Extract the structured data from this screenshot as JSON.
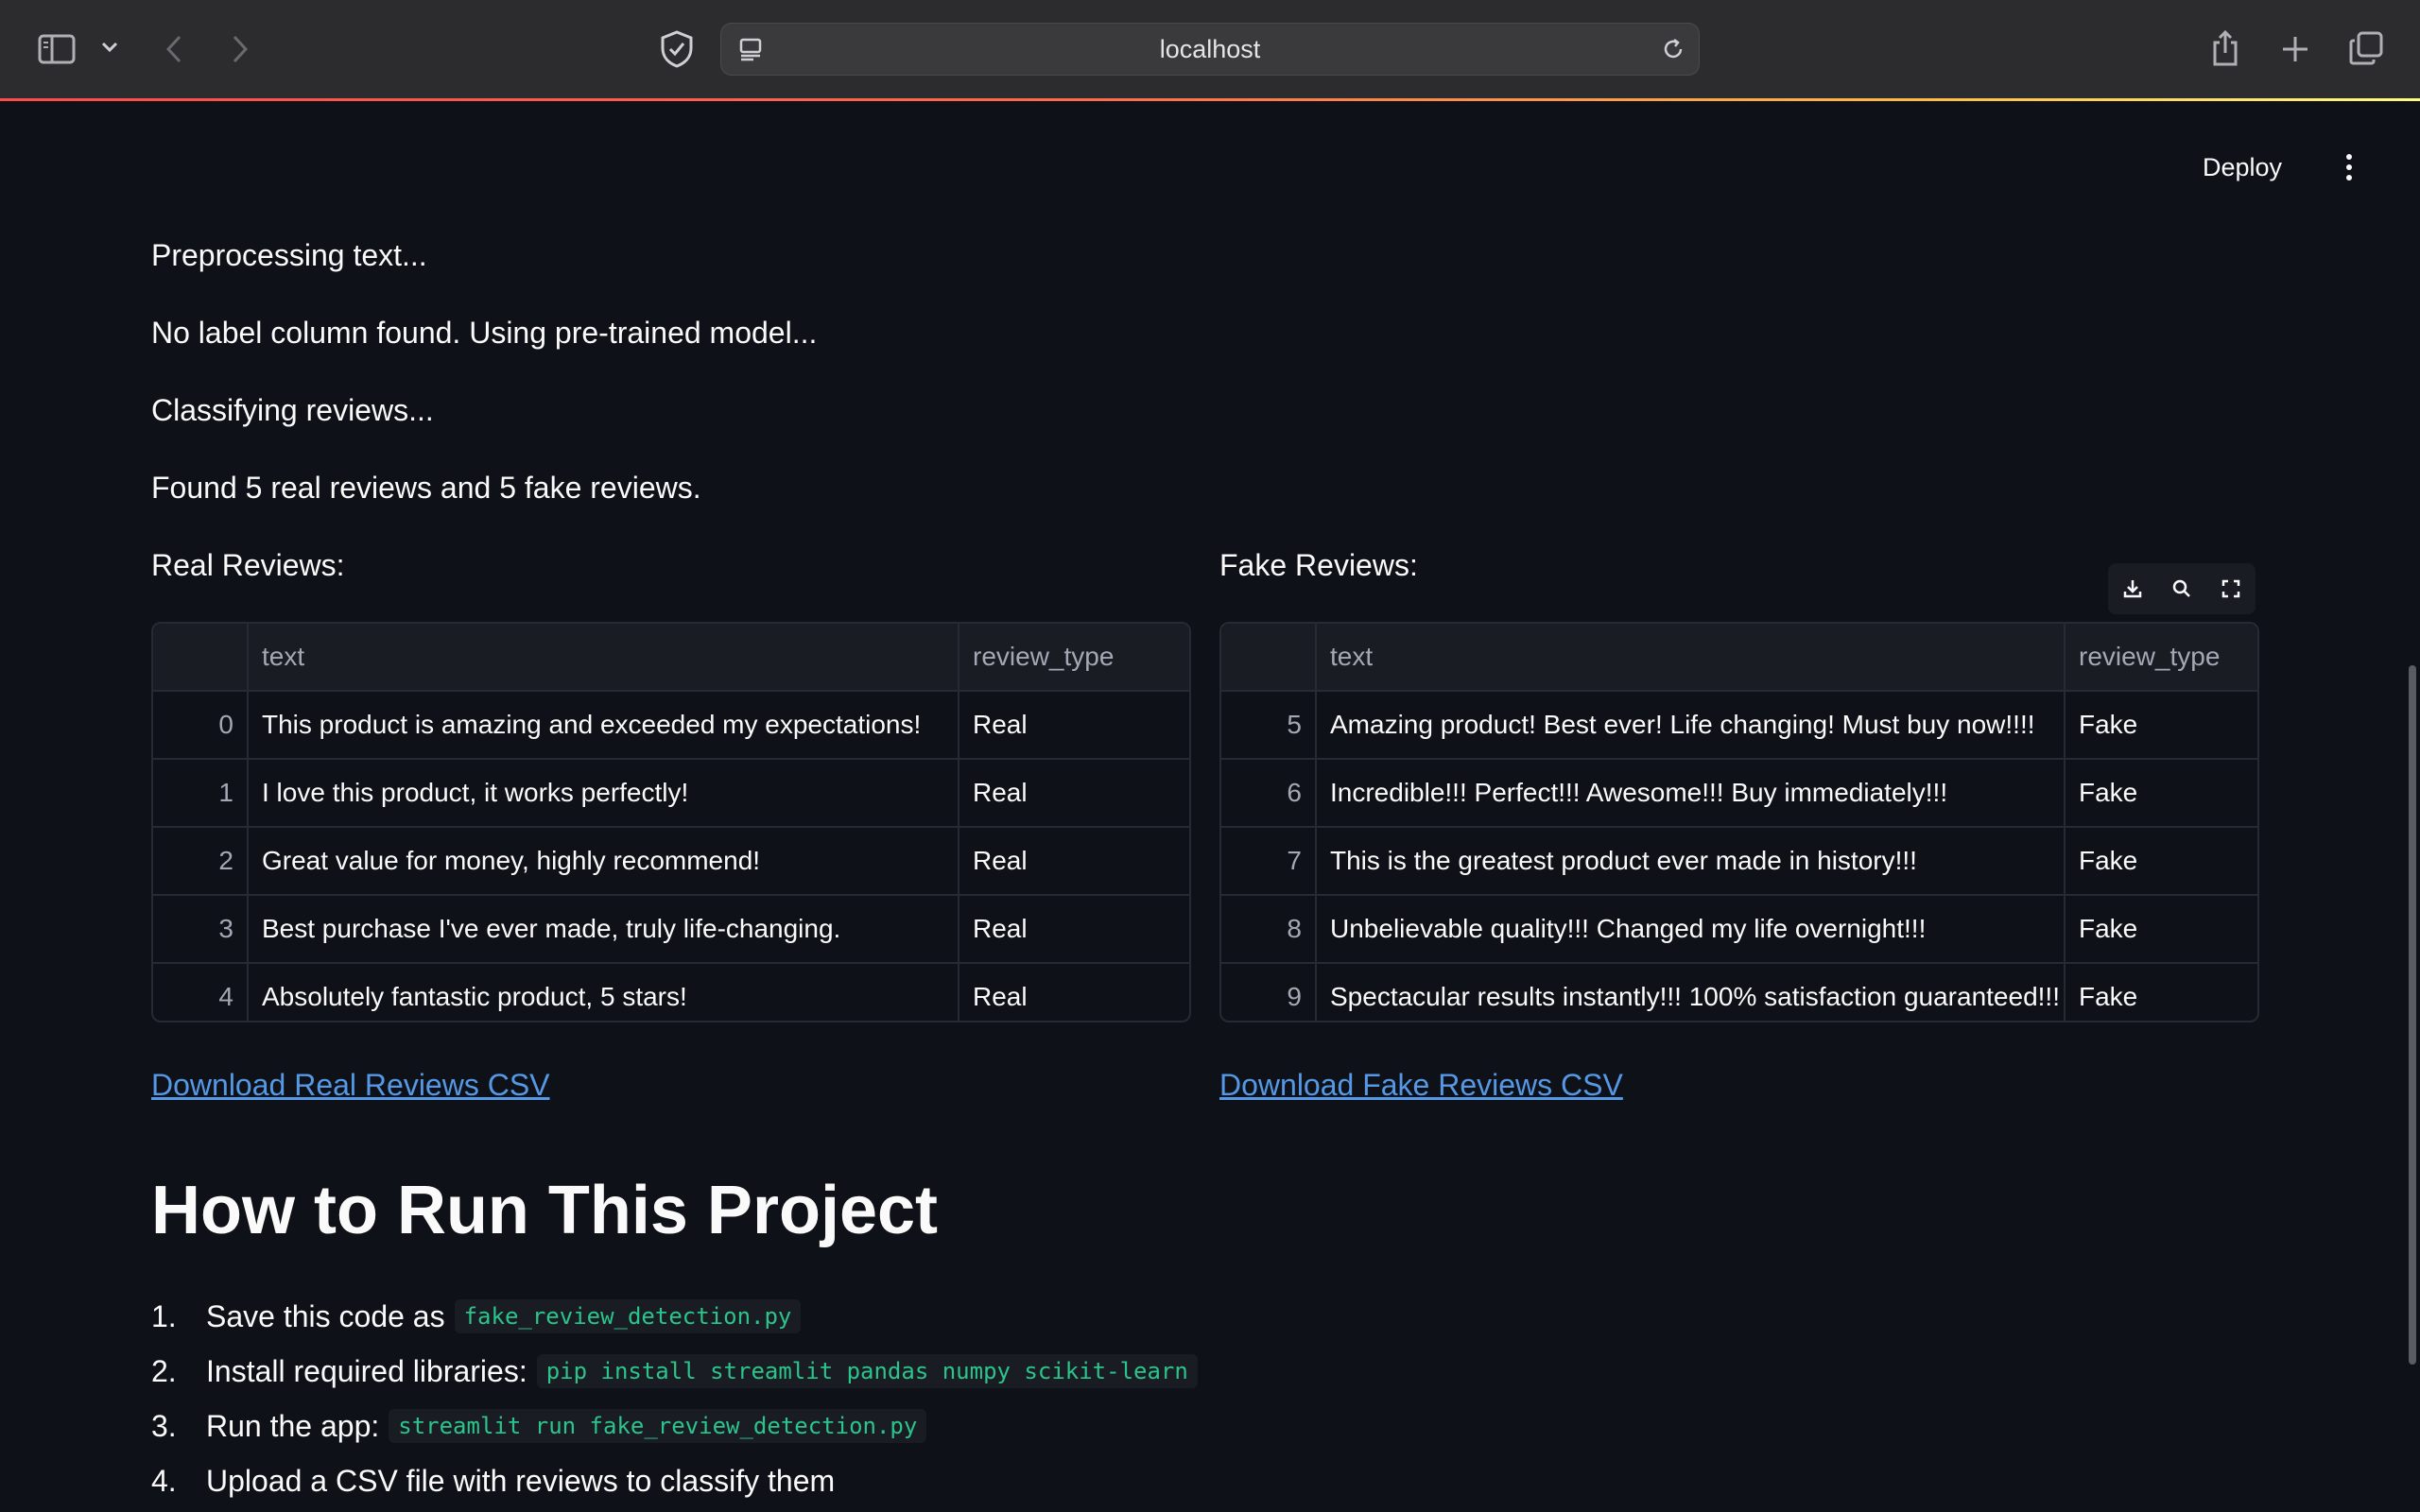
{
  "browser": {
    "url": "localhost"
  },
  "app_header": {
    "deploy_label": "Deploy"
  },
  "status": {
    "preprocessing": "Preprocessing text...",
    "no_label": "No label column found. Using pre-trained model...",
    "classifying": "Classifying reviews...",
    "found": "Found 5 real reviews and 5 fake reviews."
  },
  "real": {
    "title": "Real Reviews:",
    "columns": [
      "",
      "text",
      "review_type"
    ],
    "rows": [
      {
        "index": "0",
        "text": "This product is amazing and exceeded my expectations!",
        "type": "Real"
      },
      {
        "index": "1",
        "text": "I love this product, it works perfectly!",
        "type": "Real"
      },
      {
        "index": "2",
        "text": "Great value for money, highly recommend!",
        "type": "Real"
      },
      {
        "index": "3",
        "text": "Best purchase I've ever made, truly life-changing.",
        "type": "Real"
      },
      {
        "index": "4",
        "text": "Absolutely fantastic product, 5 stars!",
        "type": "Real"
      }
    ],
    "download_label": "Download Real Reviews CSV"
  },
  "fake": {
    "title": "Fake Reviews:",
    "columns": [
      "",
      "text",
      "review_type"
    ],
    "rows": [
      {
        "index": "5",
        "text": "Amazing product! Best ever! Life changing! Must buy now!!!!",
        "type": "Fake"
      },
      {
        "index": "6",
        "text": "Incredible!!! Perfect!!! Awesome!!! Buy immediately!!!",
        "type": "Fake"
      },
      {
        "index": "7",
        "text": "This is the greatest product ever made in history!!!",
        "type": "Fake"
      },
      {
        "index": "8",
        "text": "Unbelievable quality!!! Changed my life overnight!!!",
        "type": "Fake"
      },
      {
        "index": "9",
        "text": "Spectacular results instantly!!! 100% satisfaction guaranteed!!!",
        "type": "Fake"
      }
    ],
    "download_label": "Download Fake Reviews CSV"
  },
  "instructions": {
    "heading": "How to Run This Project",
    "steps": [
      {
        "num": "1.",
        "text": "Save this code as",
        "code": "fake_review_detection.py"
      },
      {
        "num": "2.",
        "text": "Install required libraries:",
        "code": "pip install streamlit pandas numpy scikit-learn"
      },
      {
        "num": "3.",
        "text": "Run the app:",
        "code": "streamlit run fake_review_detection.py"
      },
      {
        "num": "4.",
        "text": "Upload a CSV file with reviews to classify them",
        "code": ""
      }
    ]
  },
  "colors": {
    "background": "#0e1117",
    "link": "#5598e6",
    "code_text": "#2bc48a",
    "accent_bar_start": "#ff4b4b",
    "accent_bar_end": "#fffd80"
  }
}
